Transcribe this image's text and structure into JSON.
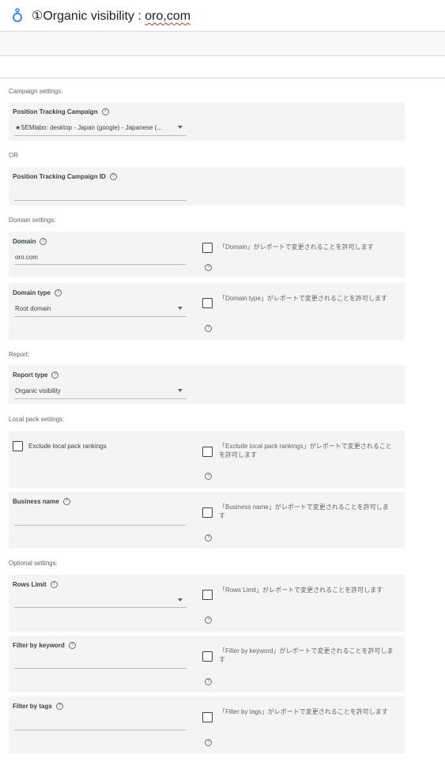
{
  "header": {
    "title_prefix": "①Organic visibility : ",
    "title_domain": "oro,com"
  },
  "sections": {
    "campaign": "Campaign settings:",
    "or": "OR",
    "domain": "Domain settings:",
    "report": "Report:",
    "local_pack": "Local pack settings:",
    "optional": "Optional settings:"
  },
  "help_glyph": "?",
  "fields": {
    "campaign": {
      "label": "Position Tracking Campaign",
      "value": "★SEMlabo: desktop - Japan (google) - Japanese (..."
    },
    "campaign_id": {
      "label": "Position Tracking Campaign ID",
      "value": ""
    },
    "domain": {
      "label": "Domain",
      "value": "oro.com",
      "allow_text": "「Domain」がレポートで変更されることを許可します"
    },
    "domain_type": {
      "label": "Domain type",
      "value": "Root domain",
      "allow_text": "「Domain type」がレポートで変更されることを許可します"
    },
    "report_type": {
      "label": "Report type",
      "value": "Organic visibility"
    },
    "exclude_local": {
      "label": "Exclude local pack rankings",
      "allow_text": "「Exclude local pack rankings」がレポートで変更されることを許可します"
    },
    "business_name": {
      "label": "Business name",
      "value": "",
      "allow_text": "「Business name」がレポートで変更されることを許可します"
    },
    "rows_limit": {
      "label": "Rows Limit",
      "value": "",
      "allow_text": "「Rows Limit」がレポートで変更されることを許可します"
    },
    "filter_keyword": {
      "label": "Filter by keyword",
      "value": "",
      "allow_text": "「Filter by keyword」がレポートで変更されることを許可します"
    },
    "filter_tags": {
      "label": "Filter by tags",
      "value": "",
      "allow_text": "「Filter by tags」がレポートで変更されることを許可します"
    }
  },
  "colors": {
    "card_bg": "#f4f4f4",
    "logo_blue": "#4285f4",
    "spell_underline": "#d93025"
  },
  "icons": {
    "logo": "data-studio-logo-icon",
    "help": "help-circle-icon",
    "caret": "dropdown-caret-icon",
    "checkbox": "checkbox-unchecked-icon"
  }
}
